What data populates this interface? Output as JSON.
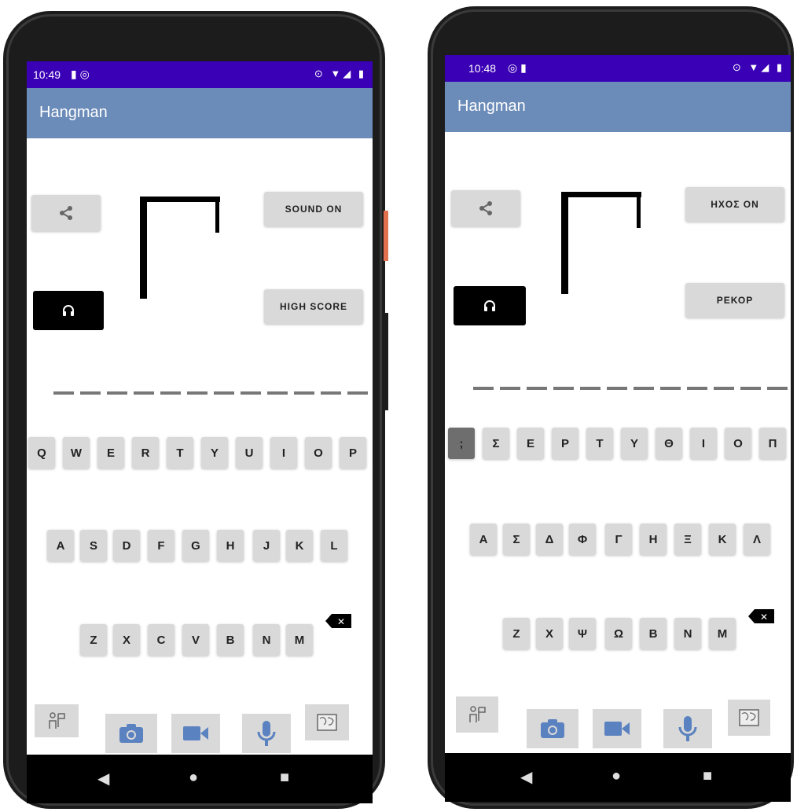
{
  "left": {
    "status_time": "10:49",
    "status_left_icons": "▮ ◎",
    "status_right_icons": "⊙ ▼◢ ▮",
    "app_title": "Hangman",
    "share_icon": "share-icon",
    "sound_button": "SOUND ON",
    "highscore_button": "HIGH SCORE",
    "headset_icon": "headset-icon",
    "keyboard_rows": [
      [
        "Q",
        "W",
        "E",
        "R",
        "T",
        "Y",
        "U",
        "I",
        "O",
        "P"
      ],
      [
        "A",
        "S",
        "D",
        "F",
        "G",
        "H",
        "J",
        "K",
        "L"
      ],
      [
        "Z",
        "X",
        "C",
        "V",
        "B",
        "N",
        "M"
      ]
    ]
  },
  "right": {
    "status_time": "10:48",
    "status_left_icons": "◎ ▮",
    "status_right_icons": "⊙ ▼◢ ▮",
    "app_title": "Hangman",
    "share_icon": "share-icon",
    "sound_button": "ΗΧΟΣ ON",
    "highscore_button": "ΡΕΚΟΡ",
    "headset_icon": "headset-icon",
    "keyboard_rows": [
      [
        ";",
        "Σ",
        "Ε",
        "Ρ",
        "Τ",
        "Υ",
        "Θ",
        "Ι",
        "Ο",
        "Π"
      ],
      [
        "Α",
        "Σ",
        "Δ",
        "Φ",
        "Γ",
        "Η",
        "Ξ",
        "Κ",
        "Λ"
      ],
      [
        "Ζ",
        "Χ",
        "Ψ",
        "Ω",
        "Β",
        "Ν",
        "Μ"
      ]
    ]
  },
  "nav": {
    "back": "◀",
    "home": "●",
    "recents": "■"
  },
  "colors": {
    "status_bar": "#3a00b5",
    "app_bar": "#6b8bb8",
    "tool_icon": "#5b82c0"
  }
}
